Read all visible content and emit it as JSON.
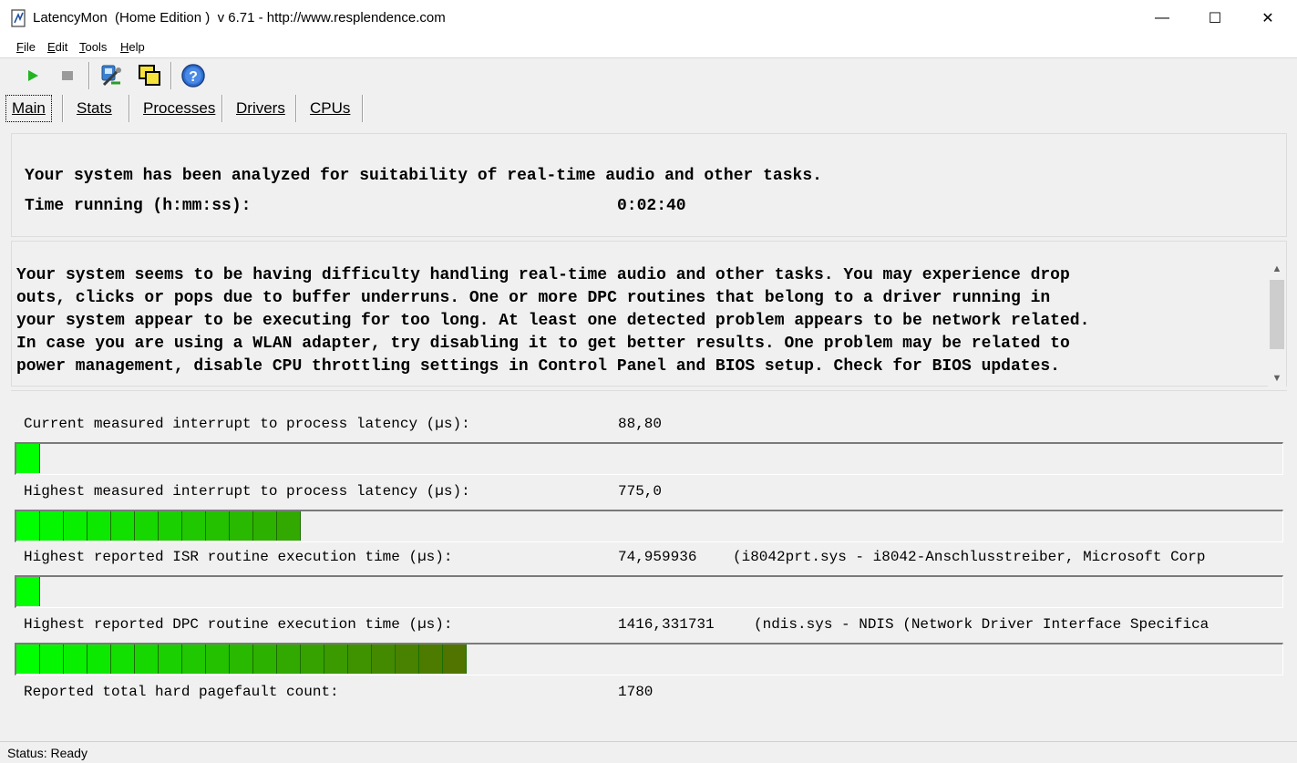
{
  "window": {
    "title": "LatencyMon  (Home Edition )  v 6.71 - http://www.resplendence.com",
    "controls": {
      "minimize": "—",
      "maximize": "☐",
      "close": "✕"
    }
  },
  "menu": {
    "items": [
      {
        "label": "File",
        "accel": "F",
        "rest": "ile"
      },
      {
        "label": "Edit",
        "accel": "E",
        "rest": "dit"
      },
      {
        "label": "Tools",
        "accel": "T",
        "rest": "ools"
      },
      {
        "label": "Help",
        "accel": "H",
        "rest": "elp"
      }
    ]
  },
  "toolbar": {
    "buttons": [
      {
        "name": "start",
        "icon": "play-icon"
      },
      {
        "name": "stop",
        "icon": "stop-icon"
      },
      {
        "name": "submit-feedback",
        "icon": "tools-icon"
      },
      {
        "name": "window-copy",
        "icon": "windows-icon"
      },
      {
        "name": "help",
        "icon": "help-icon"
      }
    ]
  },
  "tabs": [
    {
      "label": "Main",
      "active": true
    },
    {
      "label": "Stats",
      "active": false
    },
    {
      "label": "Processes",
      "active": false
    },
    {
      "label": "Drivers",
      "active": false
    },
    {
      "label": "CPUs",
      "active": false
    }
  ],
  "summary": {
    "line1": "Your system has been analyzed for suitability of real-time audio and other tasks.",
    "time_label": "Time running (h:mm:ss):",
    "time_value": "0:02:40"
  },
  "message": {
    "text": "Your system seems to be having difficulty handling real-time audio and other tasks. You may experience drop\nouts, clicks or pops due to buffer underruns. One or more DPC routines that belong to a driver running in\nyour system appear to be executing for too long. At least one detected problem appears to be network related.\nIn case you are using a WLAN adapter, try disabling it to get better results. One problem may be related to\npower management, disable CPU throttling settings in Control Panel and BIOS setup. Check for BIOS updates."
  },
  "metrics": {
    "current_latency": {
      "label": "Current measured interrupt to process latency (µs):",
      "value": "88,80",
      "segments": 1
    },
    "highest_latency": {
      "label": "Highest measured interrupt to process latency (µs):",
      "value": "775,0",
      "segments": 12
    },
    "highest_isr": {
      "label": "Highest reported ISR routine execution time (µs):",
      "value": "74,959936",
      "desc": "(i8042prt.sys - i8042-Anschlusstreiber, Microsoft Corp",
      "segments": 1
    },
    "highest_dpc": {
      "label": "Highest reported DPC routine execution time (µs):",
      "value": "1416,331731",
      "desc": "(ndis.sys - NDIS (Network Driver Interface Specifica",
      "segments": 19
    },
    "pagefault": {
      "label": "Reported total hard pagefault count:",
      "value": "1780"
    }
  },
  "colors": {
    "bar_start": "#00ff00",
    "bar_end": "#556b00"
  },
  "status": {
    "text": "Status: Ready"
  }
}
